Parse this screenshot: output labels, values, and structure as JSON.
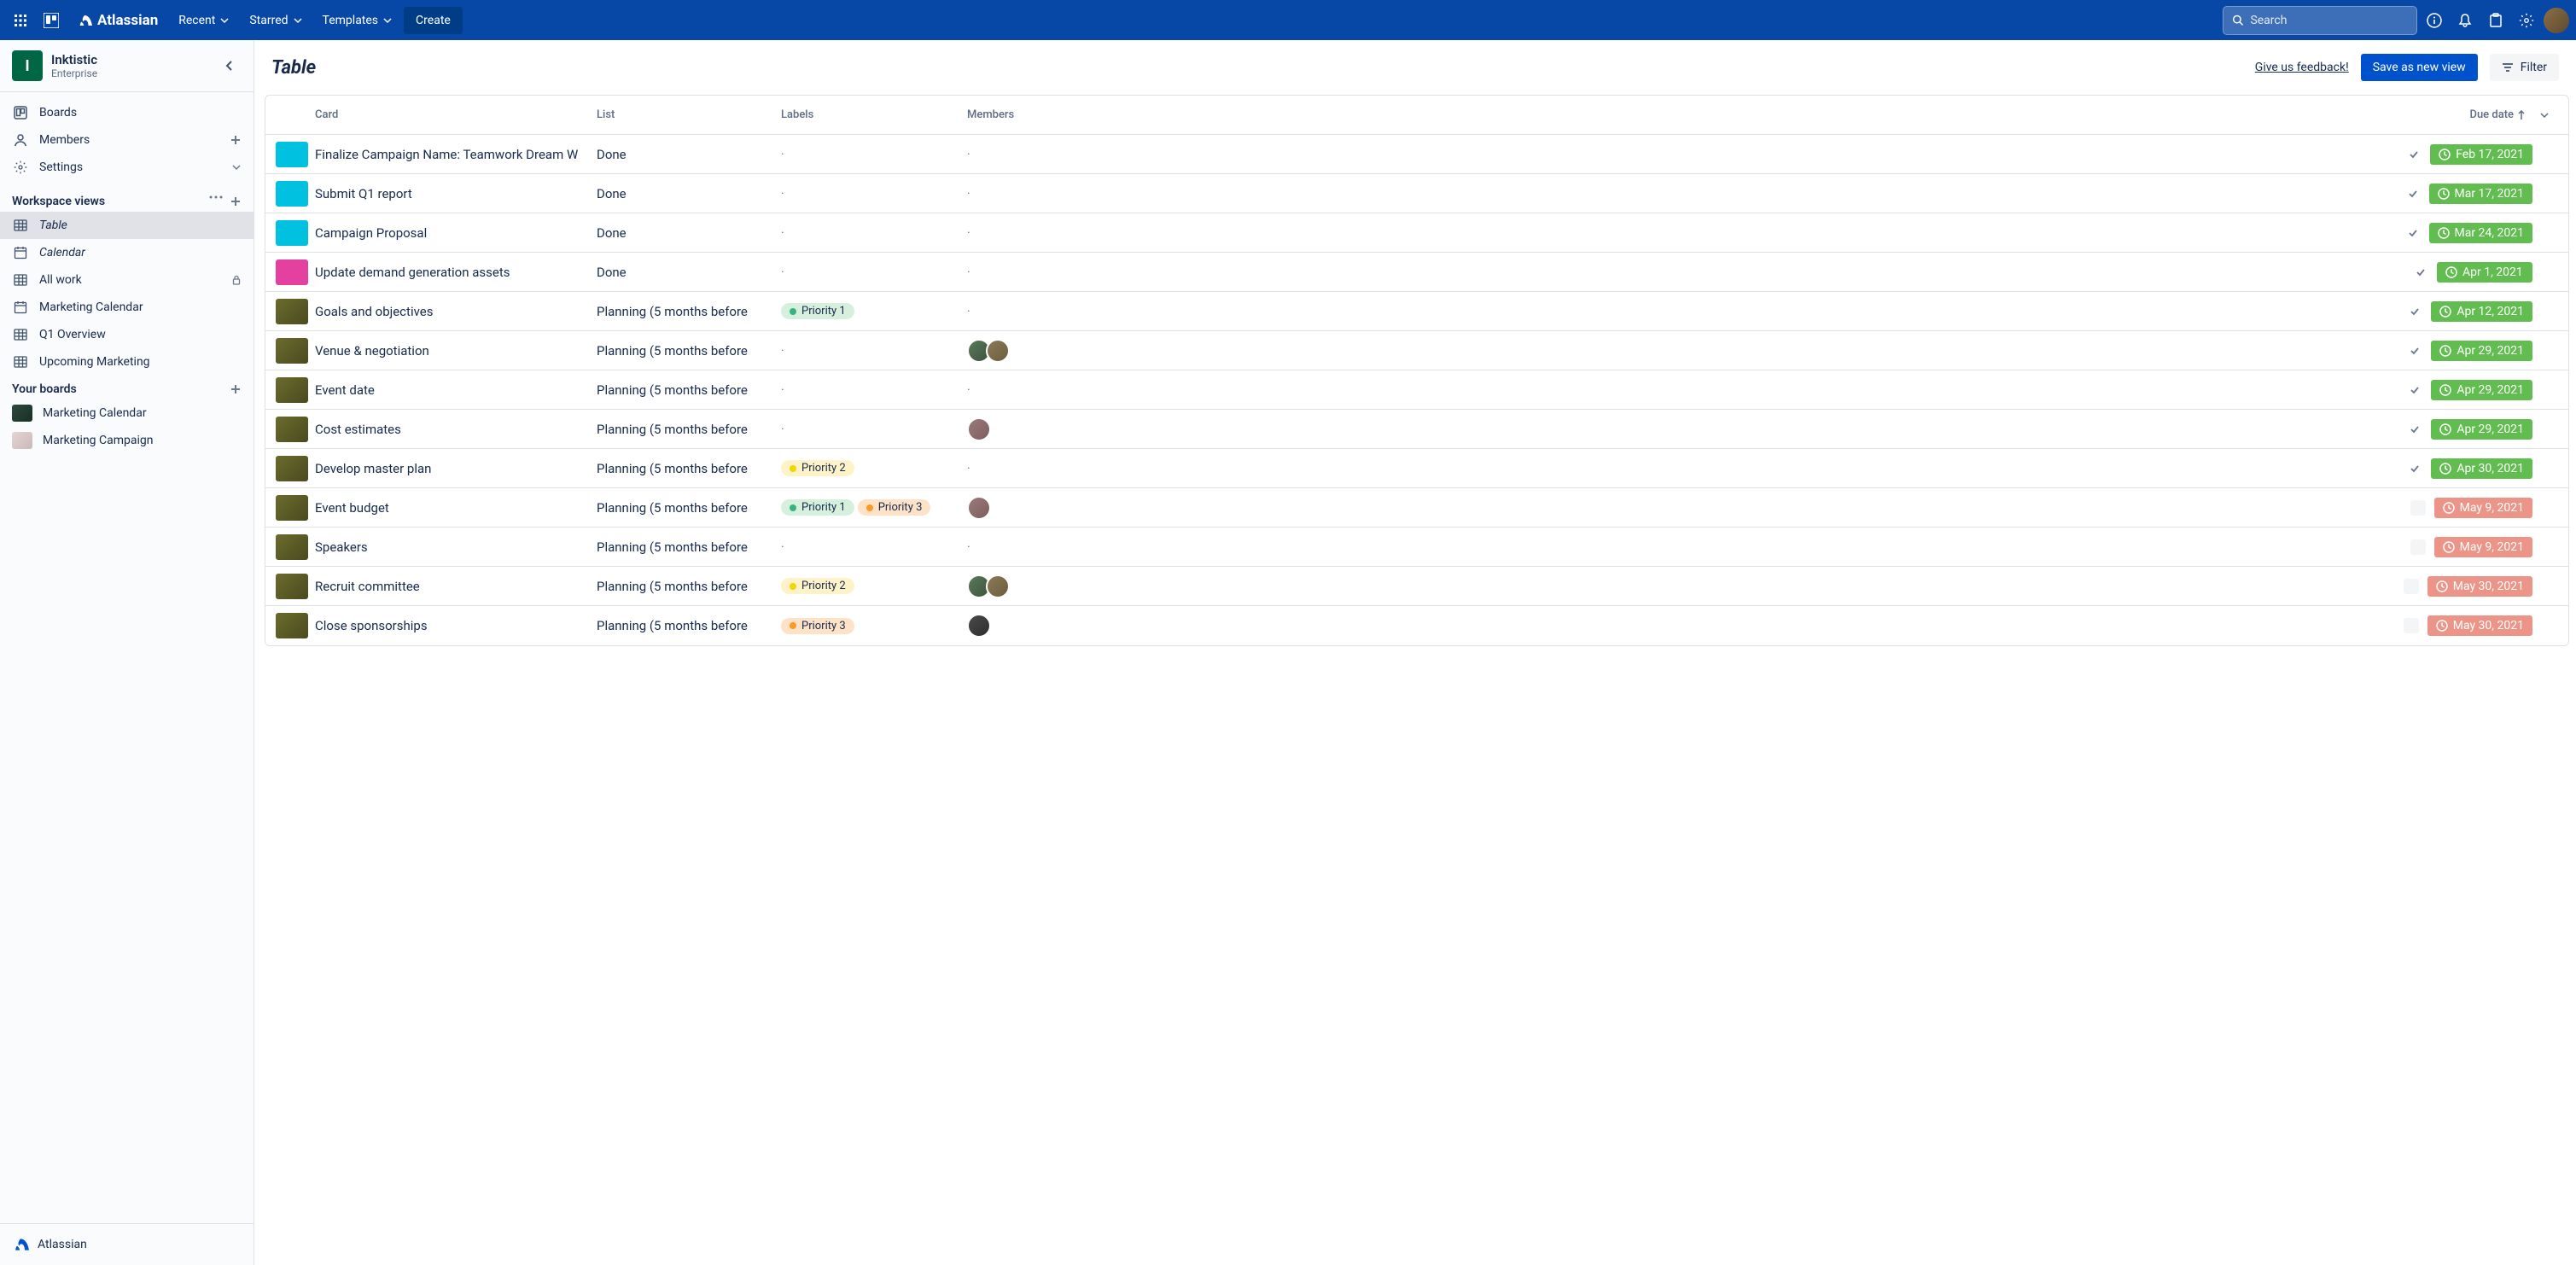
{
  "topbar": {
    "brand": "Atlassian",
    "menus": [
      "Recent",
      "Starred",
      "Templates"
    ],
    "create": "Create",
    "searchPlaceholder": "Search"
  },
  "workspace": {
    "initial": "I",
    "name": "Inktistic",
    "type": "Enterprise"
  },
  "nav": {
    "boards": "Boards",
    "members": "Members",
    "settings": "Settings"
  },
  "viewsHeader": "Workspace views",
  "views": [
    {
      "label": "Table",
      "icon": "table",
      "italic": true,
      "active": true,
      "lock": false
    },
    {
      "label": "Calendar",
      "icon": "calendar",
      "italic": true,
      "active": false,
      "lock": false
    },
    {
      "label": "All work",
      "icon": "table",
      "italic": false,
      "active": false,
      "lock": true
    },
    {
      "label": "Marketing Calendar",
      "icon": "calendar",
      "italic": false,
      "active": false,
      "lock": false
    },
    {
      "label": "Q1 Overview",
      "icon": "table",
      "italic": false,
      "active": false,
      "lock": false
    },
    {
      "label": "Upcoming Marketing",
      "icon": "table",
      "italic": false,
      "active": false,
      "lock": false
    }
  ],
  "boardsHeader": "Your boards",
  "boards": [
    {
      "label": "Marketing Calendar",
      "thumb": "bt-green"
    },
    {
      "label": "Marketing Campaign",
      "thumb": "bt-grad"
    }
  ],
  "footer": "Atlassian",
  "page": {
    "title": "Table",
    "feedback": "Give us feedback!",
    "save": "Save as new view",
    "filter": "Filter"
  },
  "columns": {
    "card": "Card",
    "list": "List",
    "labels": "Labels",
    "members": "Members",
    "due": "Due date"
  },
  "rows": [
    {
      "cover": "cc-teal",
      "title": "Finalize Campaign Name: Teamwork Dream W",
      "list": "Done",
      "labels": [],
      "members": [],
      "due": "Feb 17, 2021",
      "dueClass": "due-green",
      "checked": true
    },
    {
      "cover": "cc-teal",
      "title": "Submit Q1 report",
      "list": "Done",
      "labels": [],
      "members": [],
      "due": "Mar 17, 2021",
      "dueClass": "due-green",
      "checked": true
    },
    {
      "cover": "cc-teal",
      "title": "Campaign Proposal",
      "list": "Done",
      "labels": [],
      "members": [],
      "due": "Mar 24, 2021",
      "dueClass": "due-green",
      "checked": true
    },
    {
      "cover": "cc-pink",
      "title": "Update demand generation assets",
      "list": "Done",
      "labels": [],
      "members": [],
      "due": "Apr 1, 2021",
      "dueClass": "due-green",
      "checked": true
    },
    {
      "cover": "cc-olive",
      "title": "Goals and objectives",
      "list": "Planning (5 months before",
      "labels": [
        {
          "cls": "lbl-p1",
          "txt": "Priority 1"
        }
      ],
      "members": [],
      "due": "Apr 12, 2021",
      "dueClass": "due-green",
      "checked": true
    },
    {
      "cover": "cc-olive",
      "title": "Venue & negotiation",
      "list": "Planning (5 months before",
      "labels": [],
      "members": [
        "m1",
        "m2"
      ],
      "due": "Apr 29, 2021",
      "dueClass": "due-green",
      "checked": true
    },
    {
      "cover": "cc-olive",
      "title": "Event date",
      "list": "Planning (5 months before",
      "labels": [],
      "members": [],
      "due": "Apr 29, 2021",
      "dueClass": "due-green",
      "checked": true
    },
    {
      "cover": "cc-olive",
      "title": "Cost estimates",
      "list": "Planning (5 months before",
      "labels": [],
      "members": [
        "m3"
      ],
      "due": "Apr 29, 2021",
      "dueClass": "due-green",
      "checked": true
    },
    {
      "cover": "cc-olive",
      "title": "Develop master plan",
      "list": "Planning (5 months before",
      "labels": [
        {
          "cls": "lbl-p2",
          "txt": "Priority 2"
        }
      ],
      "members": [],
      "due": "Apr 30, 2021",
      "dueClass": "due-green",
      "checked": true
    },
    {
      "cover": "cc-olive",
      "title": "Event budget",
      "list": "Planning (5 months before",
      "labels": [
        {
          "cls": "lbl-p1",
          "txt": "Priority 1"
        },
        {
          "cls": "lbl-p3",
          "txt": "Priority 3"
        }
      ],
      "members": [
        "m3"
      ],
      "due": "May 9, 2021",
      "dueClass": "due-red",
      "checked": false
    },
    {
      "cover": "cc-olive",
      "title": "Speakers",
      "list": "Planning (5 months before",
      "labels": [],
      "members": [],
      "due": "May 9, 2021",
      "dueClass": "due-red",
      "checked": false
    },
    {
      "cover": "cc-olive",
      "title": "Recruit committee",
      "list": "Planning (5 months before",
      "labels": [
        {
          "cls": "lbl-p2",
          "txt": "Priority 2"
        }
      ],
      "members": [
        "m1",
        "m2"
      ],
      "due": "May 30, 2021",
      "dueClass": "due-red",
      "checked": false
    },
    {
      "cover": "cc-olive",
      "title": "Close sponsorships",
      "list": "Planning (5 months before",
      "labels": [
        {
          "cls": "lbl-p3",
          "txt": "Priority 3"
        }
      ],
      "members": [
        "m4"
      ],
      "due": "May 30, 2021",
      "dueClass": "due-red",
      "checked": false
    }
  ]
}
